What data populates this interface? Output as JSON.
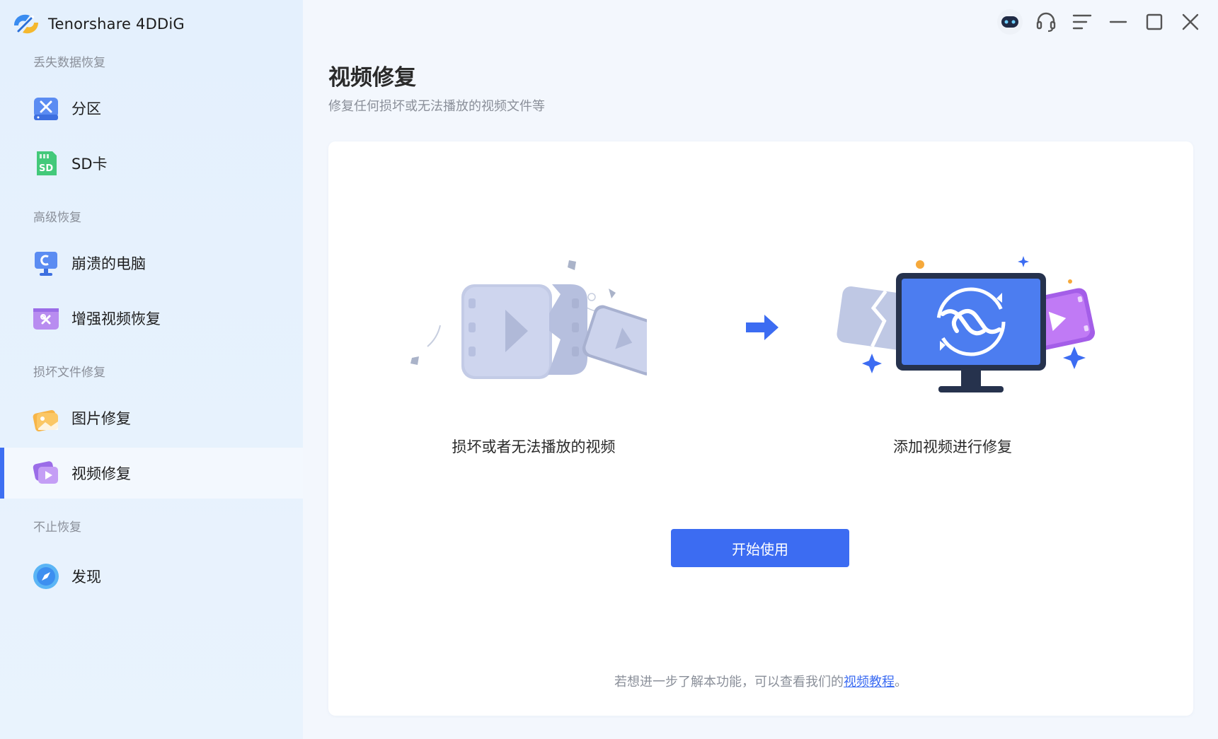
{
  "app": {
    "title": "Tenorshare 4DDiG"
  },
  "sidebar": {
    "sections": [
      {
        "label": "丢失数据恢复",
        "items": [
          {
            "label": "分区",
            "icon": "partition-icon"
          },
          {
            "label": "SD卡",
            "icon": "sd-card-icon"
          }
        ]
      },
      {
        "label": "高级恢复",
        "items": [
          {
            "label": "崩溃的电脑",
            "icon": "crashed-pc-icon"
          },
          {
            "label": "增强视频恢复",
            "icon": "enhanced-video-icon"
          }
        ]
      },
      {
        "label": "损坏文件修复",
        "items": [
          {
            "label": "图片修复",
            "icon": "photo-repair-icon"
          },
          {
            "label": "视频修复",
            "icon": "video-repair-icon",
            "active": true
          }
        ]
      },
      {
        "label": "不止恢复",
        "items": [
          {
            "label": "发现",
            "icon": "discover-icon"
          }
        ]
      }
    ]
  },
  "window_controls": [
    "robot-assistant-icon",
    "headset-icon",
    "menu-icon",
    "minimize-icon",
    "maximize-icon",
    "close-icon"
  ],
  "main": {
    "title": "视频修复",
    "subtitle": "修复任何损坏或无法播放的视频文件等",
    "left_caption": "损坏或者无法播放的视频",
    "right_caption": "添加视频进行修复",
    "start_button": "开始使用",
    "footer_text": "若想进一步了解本功能，可以查看我们的",
    "footer_link": "视频教程",
    "footer_end": "。"
  },
  "colors": {
    "accent": "#3c6cf2",
    "sidebar_bg": "#e4f0fd",
    "page_bg": "#f3f7fd"
  }
}
